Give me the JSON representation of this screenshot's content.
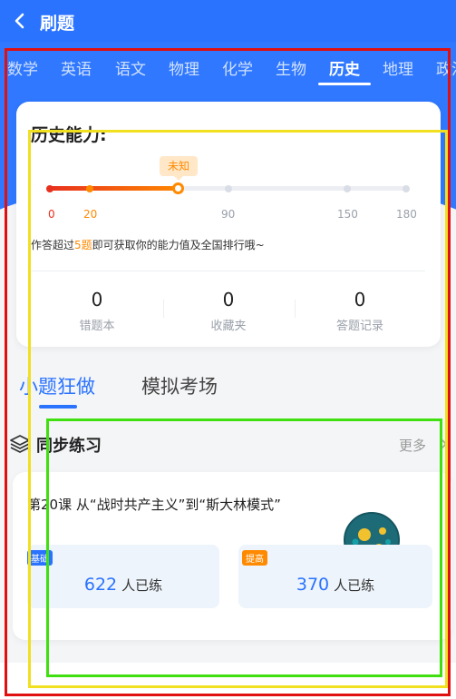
{
  "header": {
    "title": "刷题"
  },
  "subject_tabs": [
    "数学",
    "英语",
    "语文",
    "物理",
    "化学",
    "生物",
    "历史",
    "地理",
    "政治"
  ],
  "active_subject": "历史",
  "ability_card": {
    "title": "历史能力:",
    "status_tip": "未知",
    "progress_value": 50,
    "scale_ticks": [
      "0",
      "20",
      "90",
      "150",
      "180"
    ],
    "hint_prefix": "作答超过",
    "hint_highlight": "5题",
    "hint_suffix": "即可获取你的能力值及全国排行哦~"
  },
  "stats": [
    {
      "count": "0",
      "label": "错题本"
    },
    {
      "count": "0",
      "label": "收藏夹"
    },
    {
      "count": "0",
      "label": "答题记录"
    }
  ],
  "mode_tabs": [
    "小题狂做",
    "模拟考场"
  ],
  "active_mode": "小题狂做",
  "section": {
    "title": "同步练习",
    "more_label": "更多"
  },
  "lesson": {
    "title": "第20课 从“战时共产主义”到“斯大林模式”",
    "levels": [
      {
        "badge": "基础",
        "count": "622",
        "unit": "人已练"
      },
      {
        "badge": "提高",
        "count": "370",
        "unit": "人已练"
      }
    ]
  },
  "colors": {
    "brand_blue": "#2a73ff",
    "accent_orange": "#ff8a00",
    "accent_red": "#e8301e",
    "annotation_red": "#e01010",
    "annotation_yellow": "#f0e020",
    "annotation_green": "#40e010"
  },
  "icons": [
    "back-icon",
    "layers-icon",
    "chevron-right-icon",
    "planet-icon"
  ]
}
